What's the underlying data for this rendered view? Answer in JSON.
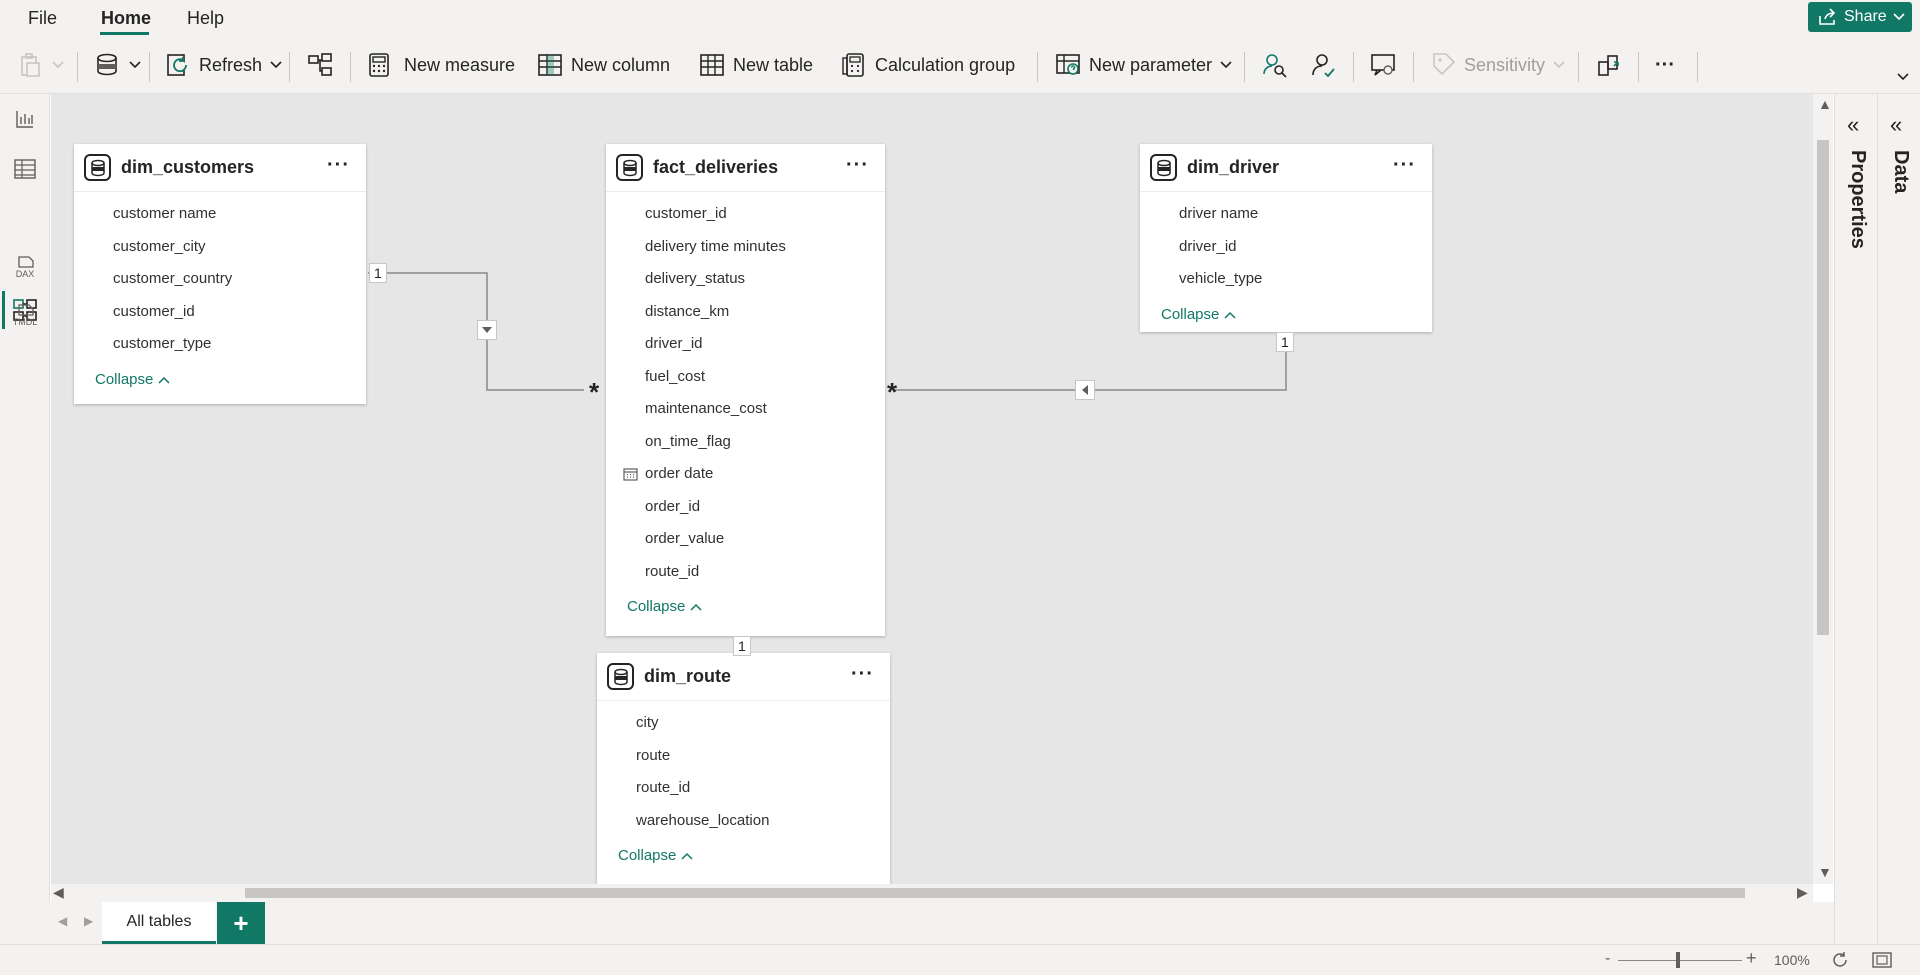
{
  "menu": {
    "file": "File",
    "home": "Home",
    "help": "Help",
    "share": "Share"
  },
  "ribbon": {
    "refresh": "Refresh",
    "new_measure": "New measure",
    "new_column": "New column",
    "new_table": "New table",
    "calculation_group": "Calculation group",
    "new_parameter": "New parameter",
    "sensitivity": "Sensitivity",
    "more": "···"
  },
  "nav": {
    "dax_label": "DAX",
    "tmdl_label": "TMDL"
  },
  "tables": {
    "dim_customers": {
      "title": "dim_customers",
      "fields": [
        "customer name",
        "customer_city",
        "customer_country",
        "customer_id",
        "customer_type"
      ],
      "collapse": "Collapse"
    },
    "fact_deliveries": {
      "title": "fact_deliveries",
      "fields": [
        "customer_id",
        "delivery time minutes",
        "delivery_status",
        "distance_km",
        "driver_id",
        "fuel_cost",
        "maintenance_cost",
        "on_time_flag",
        "order date",
        "order_id",
        "order_value",
        "route_id"
      ],
      "collapse": "Collapse"
    },
    "dim_driver": {
      "title": "dim_driver",
      "fields": [
        "driver name",
        "driver_id",
        "vehicle_type"
      ],
      "collapse": "Collapse"
    },
    "dim_route": {
      "title": "dim_route",
      "fields": [
        "city",
        "route",
        "route_id",
        "warehouse_location"
      ],
      "collapse": "Collapse"
    }
  },
  "relationships": {
    "one": "1",
    "many": "*"
  },
  "panes": {
    "properties": "Properties",
    "data": "Data"
  },
  "tabs": {
    "all_tables": "All tables",
    "add": "+"
  },
  "status": {
    "zoom": "100%",
    "zoom_minus": "-",
    "zoom_plus": "+"
  },
  "colors": {
    "accent": "#117865",
    "canvas": "#e6e6e6",
    "chrome": "#f3f2f1"
  },
  "icons": [
    "paste-icon",
    "get-data-icon",
    "refresh-icon",
    "manage-relationships-icon",
    "calculator-icon",
    "column-icon",
    "table-icon",
    "calculation-group-icon",
    "parameter-icon",
    "view-as-icon",
    "manage-roles-icon",
    "qna-icon",
    "sensitivity-icon",
    "publish-icon"
  ]
}
